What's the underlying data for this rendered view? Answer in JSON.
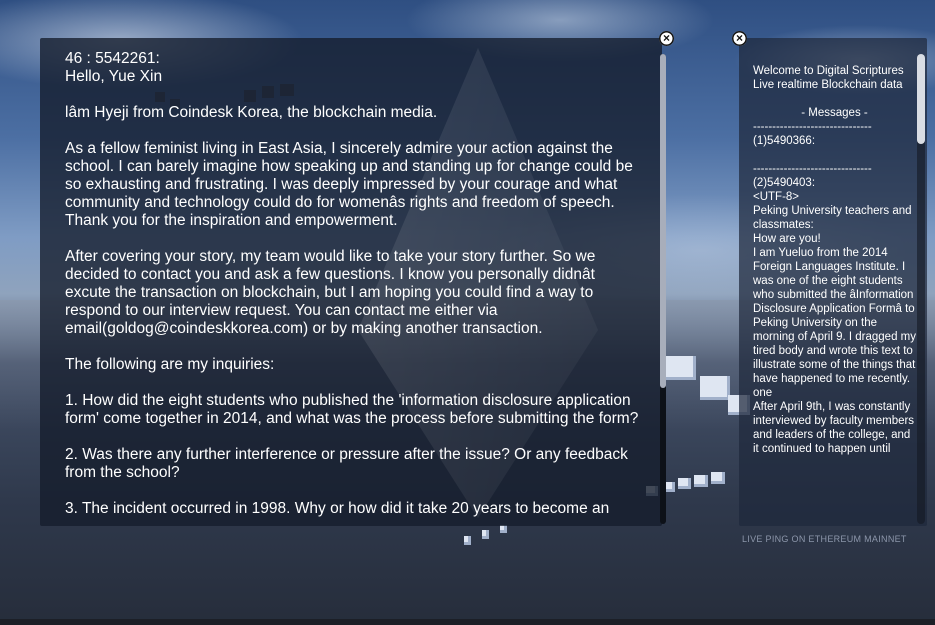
{
  "main_panel": {
    "close_icon": "x-icon",
    "paragraphs": [
      {
        "text": "46 : 5542261:\nHello, Yue Xin",
        "tight": true
      },
      {
        "text": "lâm Hyeji from Coindesk Korea, the blockchain media."
      },
      {
        "text": "As a fellow feminist living in East Asia, I sincerely admire your action against the school. I can barely imagine how speaking up and standing up for change could be so exhausting and frustrating. I was deeply impressed by your courage and what community and technology could do for womenâs rights and freedom of speech. Thank you for the inspiration and empowerment."
      },
      {
        "text": "After covering your story, my team would like to take your story further. So we decided to contact you and ask a few questions. I know you personally didnât excute the transaction on blockchain, but I am hoping you could find a way to respond to our interview request. You can contact me either via email(goldog@coindeskkorea.com) or by making another transaction."
      },
      {
        "text": "The following are my inquiries:"
      },
      {
        "text": "1. How did the eight students who published the 'information disclosure application form' come together in 2014, and what was the process before submitting the form?"
      },
      {
        "text": "2. Was there any further interference or pressure after the issue? Or any feedback from the school?"
      },
      {
        "text": "3. The incident occurred in 1998. Why or how did it take 20 years to become an"
      }
    ]
  },
  "side_panel": {
    "close_icon": "x-icon",
    "welcome": "Welcome to Digital Scriptures\nLive realtime Blockchain data",
    "messages_header": "- Messages -",
    "divider": "-------------------------------",
    "msg1_id": "(1)5490366:",
    "msg2_id": "(2)5490403:",
    "msg2_text": "<UTF-8>\nPeking University teachers and classmates:\nHow are you!\nI am Yueluo from the 2014 Foreign Languages Institute. I was one of the eight students who submitted the âInformation Disclosure Application Formâ to Peking University on the morning of April 9. I dragged my tired body and wrote this text to illustrate some of the things that have happened to me recently.\none\nAfter April 9th, I was constantly interviewed by faculty members and leaders of the college, and it continued to happen until"
  },
  "footer": {
    "label": "LIVE PING ON ETHEREUM MAINNET"
  }
}
